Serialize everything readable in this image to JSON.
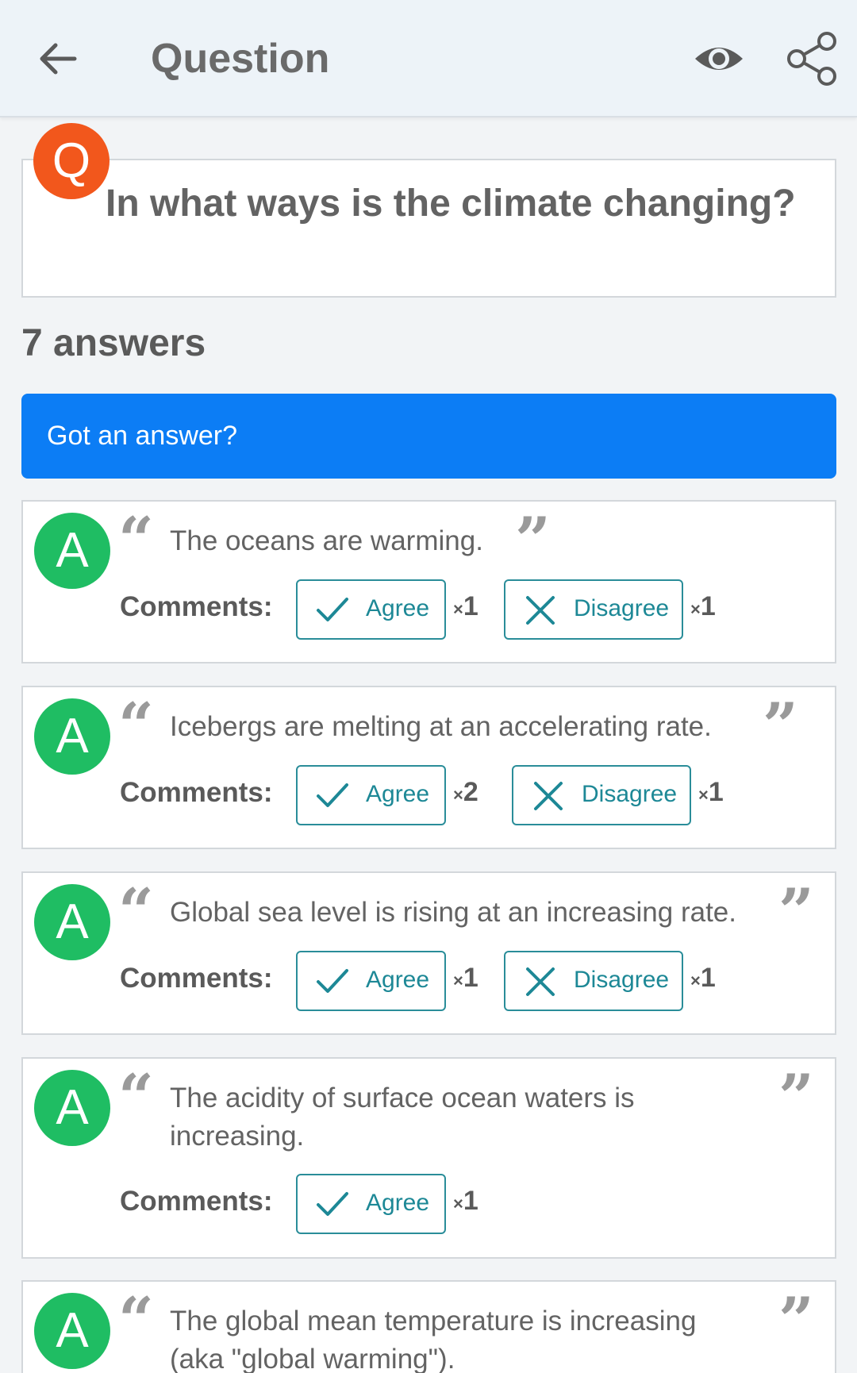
{
  "header": {
    "title": "Question",
    "back_icon": "arrow-left-icon",
    "watch_icon": "eye-icon",
    "share_icon": "share-icon"
  },
  "question": {
    "badge": "Q",
    "text": "In what ways is the climate changing?"
  },
  "answers_count_label": "7 answers",
  "cta_label": "Got an answer?",
  "answer_badge": "A",
  "comments_label": "Comments:",
  "agree_label": "Agree",
  "disagree_label": "Disagree",
  "times_symbol": "×",
  "answers": [
    {
      "text": "The oceans are warming.",
      "agree": "1",
      "disagree": "1"
    },
    {
      "text": "Icebergs are melting at an accelerating rate.",
      "agree": "2",
      "disagree": "1"
    },
    {
      "text": "Global sea level is rising at an increasing rate.",
      "agree": "1",
      "disagree": "1"
    },
    {
      "text": "The acidity of surface ocean waters is increasing.",
      "agree": "1"
    },
    {
      "text": "The global mean temperature is increasing (aka \"global warming\")."
    }
  ],
  "colors": {
    "question_badge": "#f2571c",
    "answer_badge": "#1fbd63",
    "cta": "#0c7df5",
    "vote_accent": "#1d8896"
  }
}
